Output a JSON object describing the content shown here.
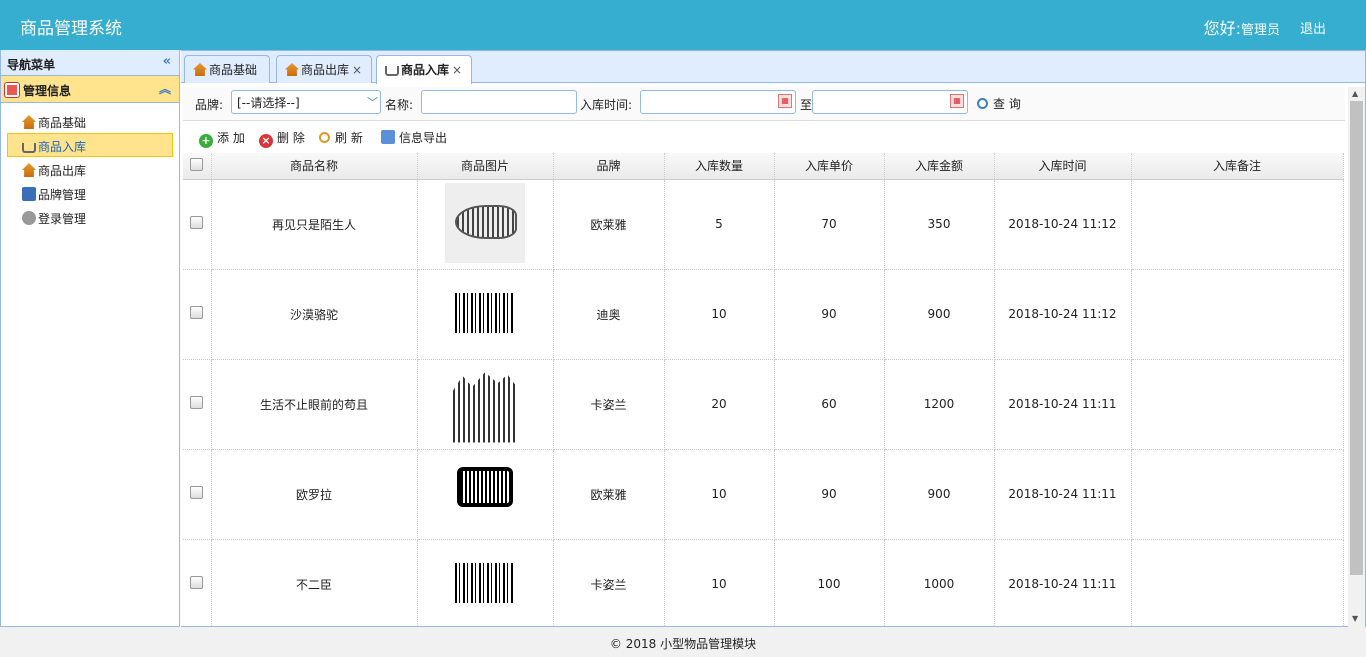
{
  "header": {
    "title": "商品管理系统",
    "greeting": "您好:",
    "user": "管理员",
    "logout": "退出"
  },
  "sidebar": {
    "title": "导航菜单",
    "group": "管理信息",
    "items": [
      {
        "label": "商品基础",
        "icon": "house-icon"
      },
      {
        "label": "商品入库",
        "icon": "cart-icon"
      },
      {
        "label": "商品出库",
        "icon": "house-icon"
      },
      {
        "label": "品牌管理",
        "icon": "book-icon"
      },
      {
        "label": "登录管理",
        "icon": "gear-icon"
      }
    ]
  },
  "tabs": [
    {
      "label": "商品基础"
    },
    {
      "label": "商品出库"
    },
    {
      "label": "商品入库"
    }
  ],
  "filters": {
    "brand_label": "品牌:",
    "brand_value": "[--请选择--]",
    "name_label": "名称:",
    "time_label": "入库时间:",
    "to_label": "至",
    "search": "查 询"
  },
  "toolbar": {
    "add": "添 加",
    "delete": "删 除",
    "refresh": "刷 新",
    "export": "信息导出"
  },
  "table": {
    "columns": [
      "商品名称",
      "商品图片",
      "品牌",
      "入库数量",
      "入库单价",
      "入库金额",
      "入库时间",
      "入库备注"
    ],
    "rows": [
      {
        "name": "再见只是陌生人",
        "brand": "欧莱雅",
        "qty": "5",
        "price": "70",
        "amount": "350",
        "time": "2018-10-24 11:12",
        "note": ""
      },
      {
        "name": "沙漠骆驼",
        "brand": "迪奥",
        "qty": "10",
        "price": "90",
        "amount": "900",
        "time": "2018-10-24 11:12",
        "note": ""
      },
      {
        "name": "生活不止眼前的苟且",
        "brand": "卡姿兰",
        "qty": "20",
        "price": "60",
        "amount": "1200",
        "time": "2018-10-24 11:11",
        "note": ""
      },
      {
        "name": "欧罗拉",
        "brand": "欧莱雅",
        "qty": "10",
        "price": "90",
        "amount": "900",
        "time": "2018-10-24 11:11",
        "note": ""
      },
      {
        "name": "不二臣",
        "brand": "卡姿兰",
        "qty": "10",
        "price": "100",
        "amount": "1000",
        "time": "2018-10-24 11:11",
        "note": ""
      }
    ]
  },
  "footer": "© 2018 小型物品管理模块"
}
